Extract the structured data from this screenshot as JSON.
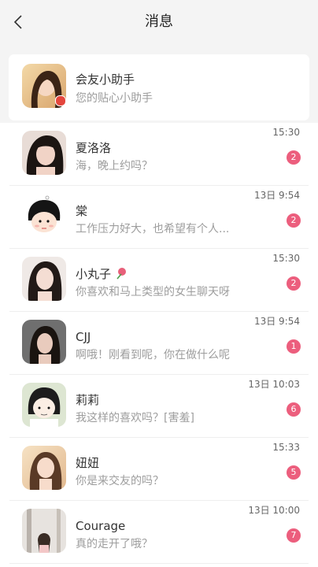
{
  "header": {
    "title": "消息"
  },
  "colors": {
    "badge": "#ec5e7d",
    "muted": "#9d9d9d"
  },
  "assistant": {
    "name": "会友小助手",
    "preview": "您的贴心小助手"
  },
  "conversations": [
    {
      "name": "夏洛洛",
      "preview": "海，晚上约吗？",
      "time": "15:30",
      "unread": "2"
    },
    {
      "name": "棠",
      "preview": "工作压力好大，也希望有个人...",
      "time": "13日 9:54",
      "unread": "2"
    },
    {
      "name": "小丸子",
      "preview": "你喜欢和马上类型的女生聊天呀",
      "time": "15:30",
      "unread": "2"
    },
    {
      "name": "CJJ",
      "preview": "啊哦！刚看到呢，你在做什么呢",
      "time": "13日 9:54",
      "unread": "1"
    },
    {
      "name": "莉莉",
      "preview": "我这样的喜欢吗？[害羞]",
      "time": "13日 10:03",
      "unread": "6"
    },
    {
      "name": "妞妞",
      "preview": "你是来交友的吗？",
      "time": "15:33",
      "unread": "5"
    },
    {
      "name": "Courage",
      "preview": "真的走开了哦？",
      "time": "13日 10:00",
      "unread": "7"
    }
  ]
}
